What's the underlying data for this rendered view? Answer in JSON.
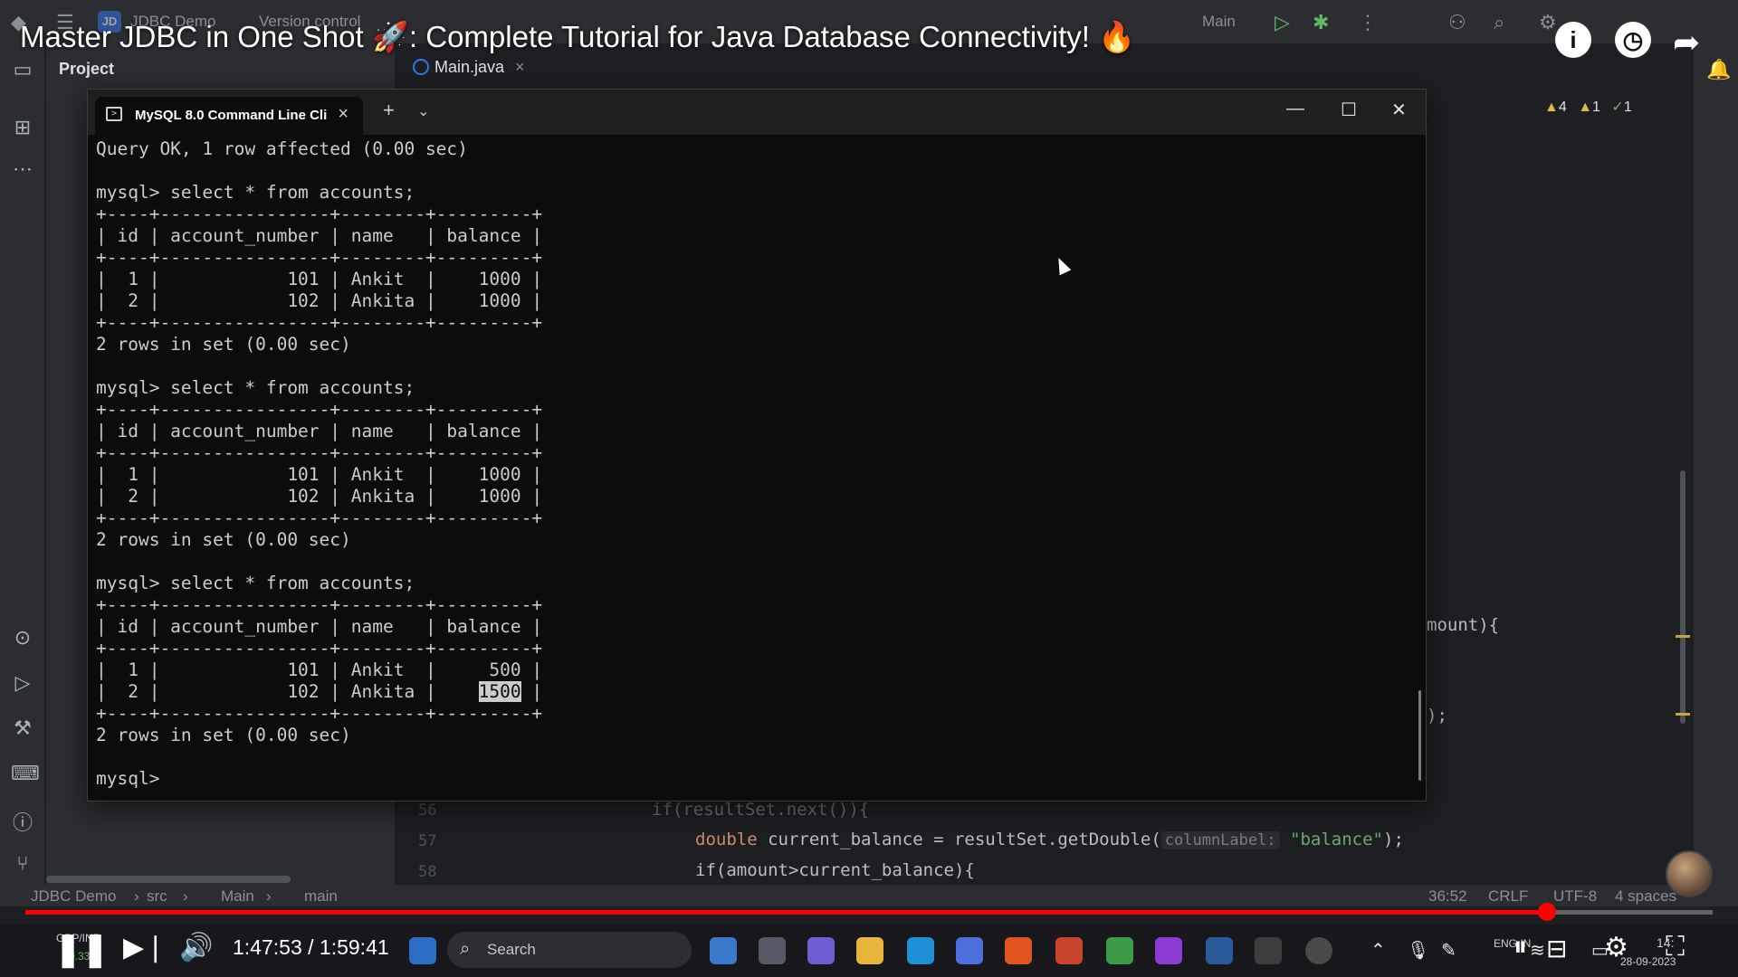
{
  "video": {
    "title": "Master JDBC in One Shot 🚀: Complete Tutorial for Java Database Connectivity! 🔥",
    "time": "1:47:53 / 1:59:41",
    "progress_fraction": 0.902
  },
  "ide": {
    "project_badge": "JD",
    "project_name": "JDBC Demo",
    "version_control": "Version control",
    "run_config": "Main",
    "panel_title": "Project",
    "editor_tab": "Main.java",
    "inspections": {
      "warnings": "4",
      "weak_warnings": "1",
      "ok": "1"
    },
    "code_fragment_right_1": "mount){",
    "code_fragment_right_2": ");",
    "code_lines": [
      {
        "num": "56",
        "text_a": "if(resultSet.next()){"
      },
      {
        "num": "57",
        "kw": "double",
        "text_a": " current_balance = resultSet.getDouble(",
        "hint": "columnLabel:",
        "str": "\"balance\"",
        "text_b": ");"
      },
      {
        "num": "58",
        "text_a": "if(amount>current_balance){"
      }
    ],
    "status": {
      "breadcrumb": [
        "JDBC Demo",
        "src",
        "Main",
        "main"
      ],
      "position": "36:52",
      "line_ending": "CRLF",
      "encoding": "UTF-8",
      "indent": "4 spaces"
    }
  },
  "terminal": {
    "tab_label": "MySQL 8.0 Command Line Cli",
    "lines": [
      "Query OK, 1 row affected (0.00 sec)",
      "",
      "mysql> select * from accounts;",
      "+----+----------------+--------+---------+",
      "| id | account_number | name   | balance |",
      "+----+----------------+--------+---------+",
      "|  1 |            101 | Ankit  |    1000 |",
      "|  2 |            102 | Ankita |    1000 |",
      "+----+----------------+--------+---------+",
      "2 rows in set (0.00 sec)",
      "",
      "mysql> select * from accounts;",
      "+----+----------------+--------+---------+",
      "| id | account_number | name   | balance |",
      "+----+----------------+--------+---------+",
      "|  1 |            101 | Ankit  |    1000 |",
      "|  2 |            102 | Ankita |    1000 |",
      "+----+----------------+--------+---------+",
      "2 rows in set (0.00 sec)",
      "",
      "mysql> select * from accounts;",
      "+----+----------------+--------+---------+",
      "| id | account_number | name   | balance |",
      "+----+----------------+--------+---------+",
      "|  1 |            101 | Ankit  |     500 |"
    ],
    "highlight_line_pre": "|  2 |            102 | Ankita |    ",
    "highlight_value": "1500",
    "highlight_line_post": " |",
    "tail_lines": [
      "+----+----------------+--------+---------+",
      "2 rows in set (0.00 sec)",
      "",
      "mysql>"
    ]
  },
  "taskbar": {
    "search_placeholder": "Search",
    "stock_label": "GBP/INR",
    "stock_change": "-0.33%",
    "clock_time": "14:",
    "clock_date": "28-09-2023",
    "lang": "ENG IN"
  }
}
